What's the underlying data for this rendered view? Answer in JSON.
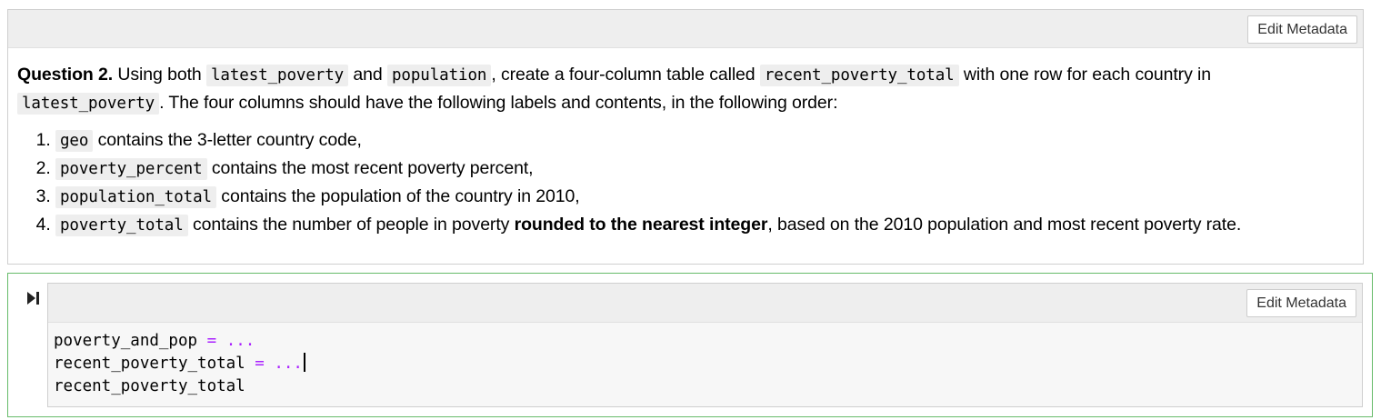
{
  "markdown_cell": {
    "edit_metadata_label": "Edit Metadata",
    "question_label": "Question 2.",
    "intro_parts": [
      " Using both ",
      "latest_poverty",
      " and ",
      "population",
      ", create a four-column table called ",
      "recent_poverty_total",
      " with one row for each country in ",
      "latest_poverty",
      ". The four columns should have the following labels and contents, in the following order:"
    ],
    "items": [
      {
        "code": "geo",
        "text": " contains the 3-letter country code,"
      },
      {
        "code": "poverty_percent",
        "text": " contains the most recent poverty percent,"
      },
      {
        "code": "population_total",
        "text": " contains the population of the country in 2010,"
      },
      {
        "code": "poverty_total",
        "text_before": " contains the number of people in poverty ",
        "bold": "rounded to the nearest integer",
        "text_after": ", based on the 2010 population and most recent poverty rate."
      }
    ]
  },
  "code_cell": {
    "edit_metadata_label": "Edit Metadata",
    "run_icon": "run-cell-icon",
    "lines": [
      {
        "name": "poverty_and_pop",
        "op": "=",
        "value": "..."
      },
      {
        "name": "recent_poverty_total",
        "op": "=",
        "value": "..."
      },
      {
        "name": "recent_poverty_total"
      }
    ]
  },
  "colors": {
    "active_cell_border": "#66bb6a",
    "operator": "#aa22ff",
    "toolbar_bg": "#eeeeee"
  }
}
